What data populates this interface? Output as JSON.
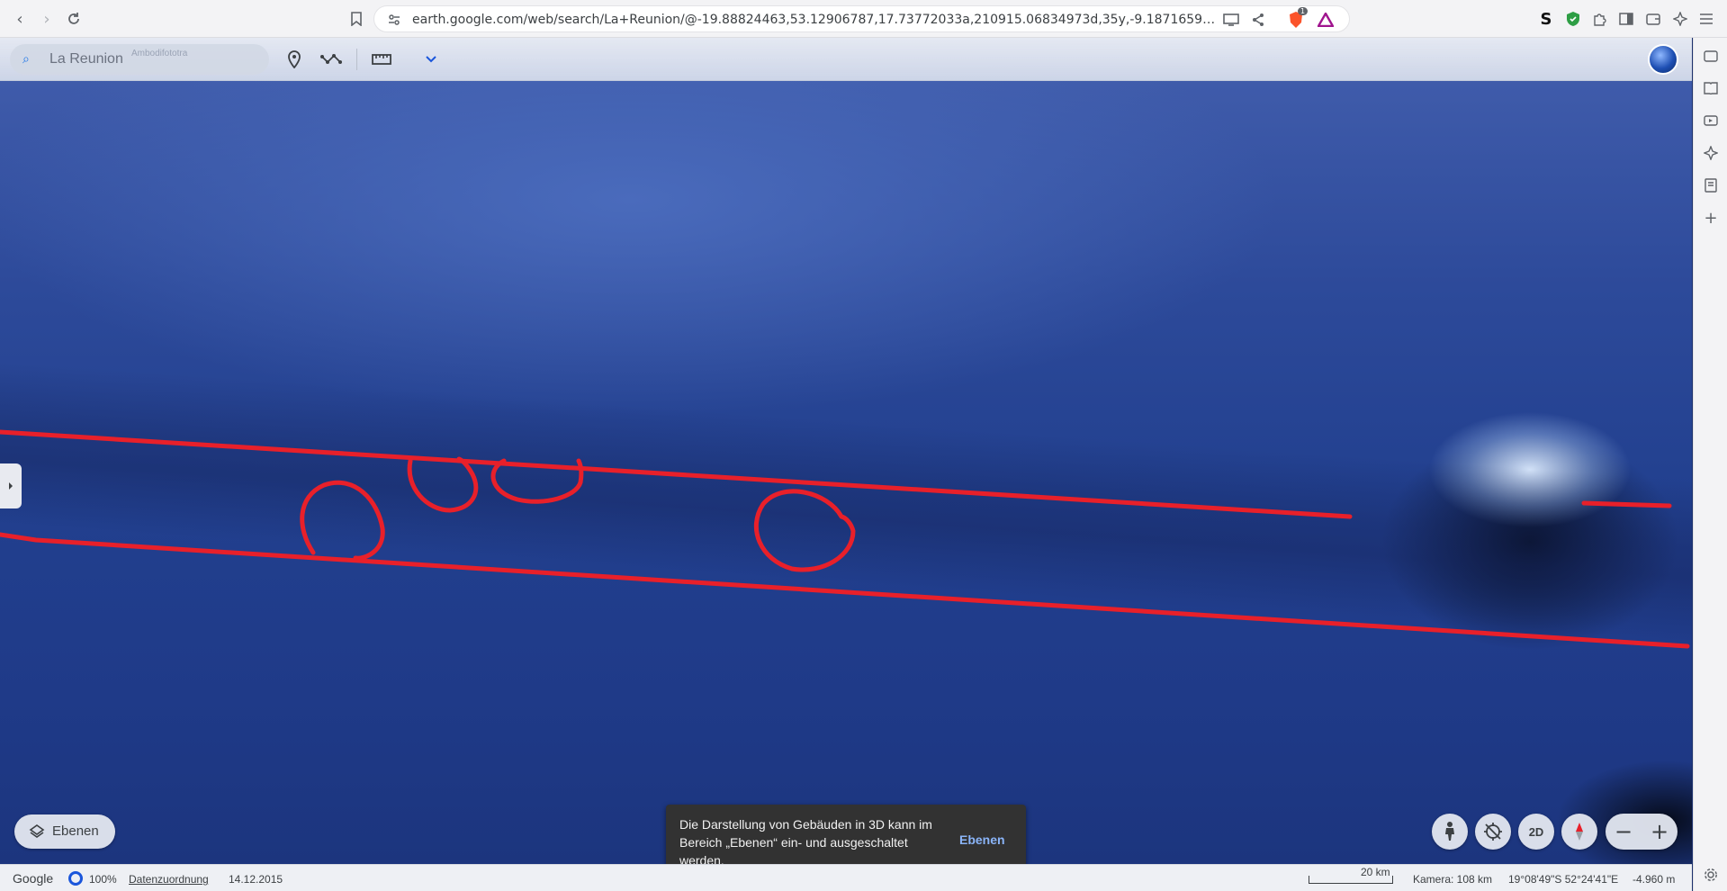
{
  "browser": {
    "url": "earth.google.com/web/search/La+Reunion/@-19.88824463,53.12906787,17.73772033a,210915.06834973d,35y,-9.18716592h,59.8768235...",
    "shields_badge": "1"
  },
  "earth_toolbar": {
    "search_placeholder": "La Reunion",
    "search_ghost_label": "Ambodifototra"
  },
  "layers_button": {
    "label": "Ebenen"
  },
  "toast": {
    "message": "Die Darstellung von Gebäuden in 3D kann im Bereich „Ebenen“ ein- und ausgeschaltet werden.",
    "action": "Ebenen"
  },
  "controls": {
    "view_mode": "2D",
    "zoom_out": "−",
    "zoom_in": "+"
  },
  "status_bar": {
    "logo": "Google",
    "loading_percent": "100%",
    "attribution_link": "Datenzuordnung",
    "imagery_date": "14.12.2015",
    "scale_label": "20 km",
    "camera": "Kamera: 108 km",
    "coordinates": "19°08'49\"S 52°24'41\"E",
    "elevation": "-4.960 m"
  },
  "colors": {
    "annotation": "#e8202a",
    "ocean": "#22408f",
    "accent": "#1a73e8",
    "toast_bg": "#323232",
    "toast_action": "#8ab4f8"
  }
}
